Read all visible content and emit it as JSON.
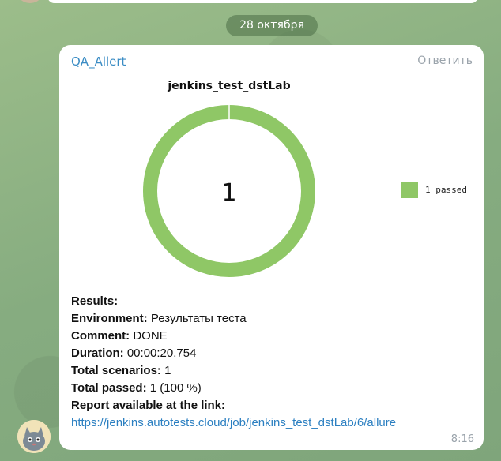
{
  "date_divider": "28 октября",
  "message": {
    "sender": "QA_Allert",
    "reply_label": "Ответить",
    "time": "8:16",
    "chart_data": {
      "type": "pie",
      "title": "jenkins_test_dstLab",
      "center_label": "1",
      "categories": [
        "passed"
      ],
      "values": [
        1
      ],
      "legend": [
        {
          "label": "1 passed",
          "color": "#8fc766"
        }
      ],
      "legend_position": "right"
    },
    "results": {
      "heading": "Results:",
      "environment_label": "Environment:",
      "environment_value": "Результаты теста",
      "comment_label": "Comment:",
      "comment_value": "DONE",
      "duration_label": "Duration:",
      "duration_value": "00:00:20.754",
      "total_scenarios_label": "Total scenarios:",
      "total_scenarios_value": "1",
      "total_passed_label": "Total passed:",
      "total_passed_value": "1 (100 %)",
      "report_label": "Report available at the link:",
      "report_link": "https://jenkins.autotests.cloud/job/jenkins_test_dstLab/6/allure"
    }
  }
}
